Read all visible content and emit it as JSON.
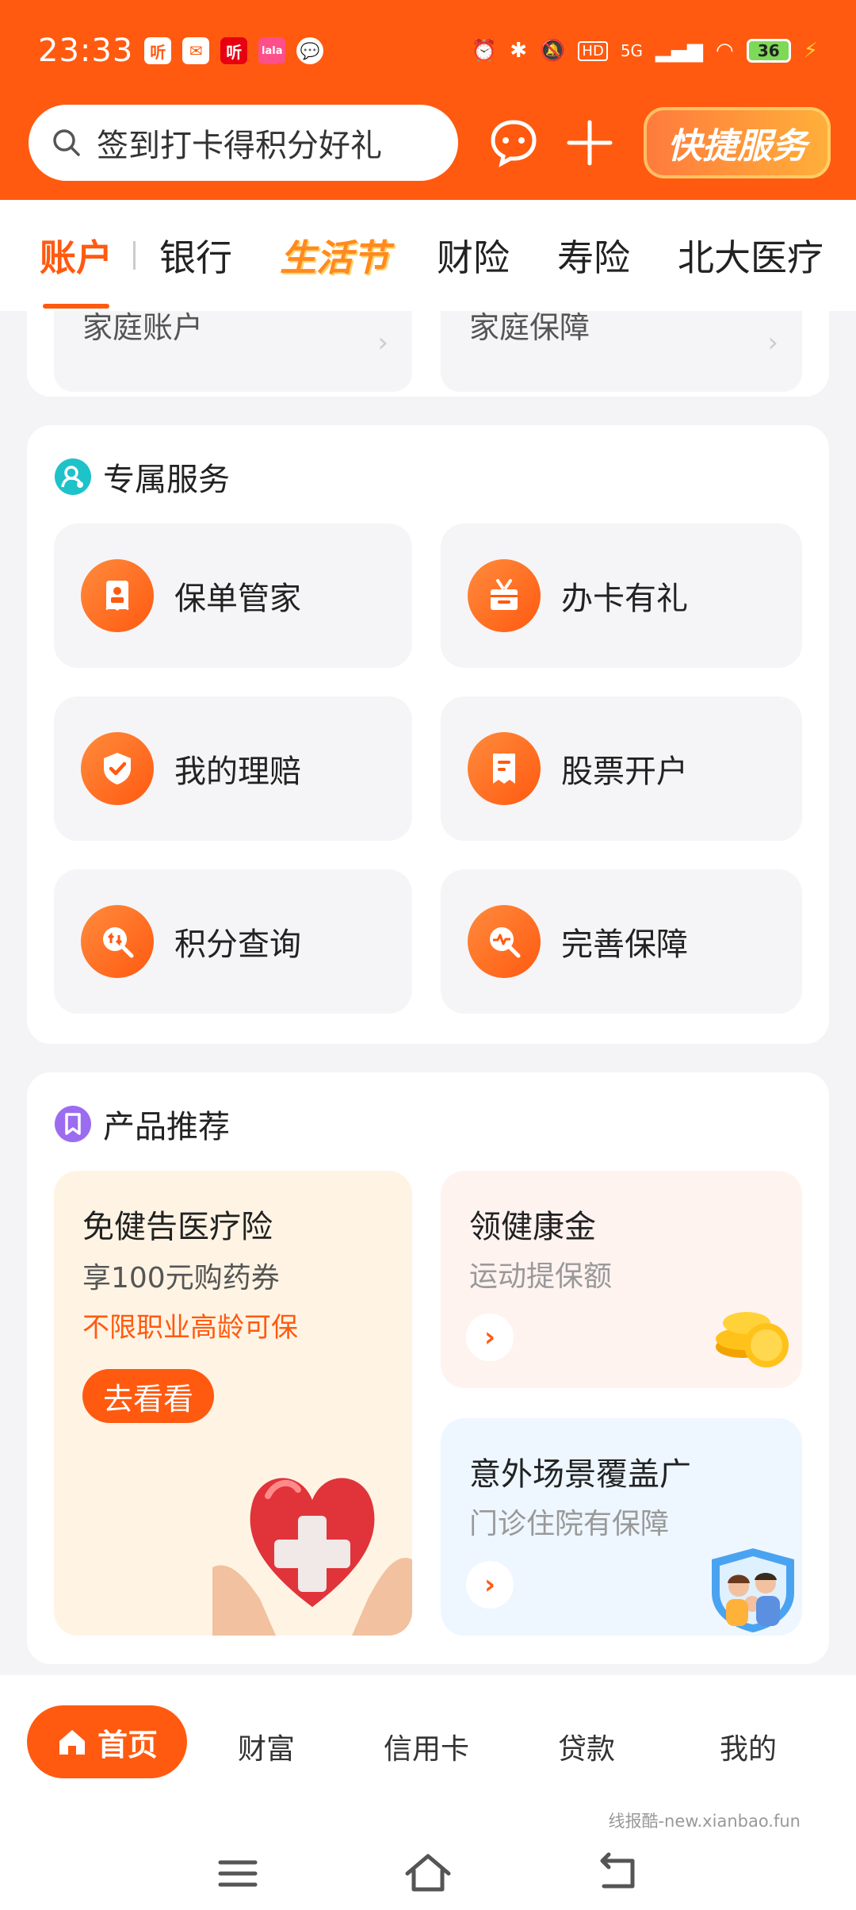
{
  "status_bar": {
    "time": "23:33",
    "app_icons": [
      "听",
      "✉",
      "听",
      "lala",
      "💬"
    ],
    "network": "5G",
    "battery": "36"
  },
  "search": {
    "placeholder": "签到打卡得积分好礼",
    "quick_service": "快捷服务"
  },
  "tabs": [
    {
      "label": "账户"
    },
    {
      "label": "银行"
    },
    {
      "label": "生活节"
    },
    {
      "label": "财险"
    },
    {
      "label": "寿险"
    },
    {
      "label": "北大医疗"
    }
  ],
  "top_card": {
    "left_label": "家庭账户",
    "right_label": "家庭保障"
  },
  "exclusive_service": {
    "title": "专属服务",
    "items": [
      {
        "label": "保单管家",
        "icon": "policy-icon"
      },
      {
        "label": "办卡有礼",
        "icon": "gift-icon"
      },
      {
        "label": "我的理赔",
        "icon": "shield-check-icon"
      },
      {
        "label": "股票开户",
        "icon": "receipt-icon"
      },
      {
        "label": "积分查询",
        "icon": "points-search-icon"
      },
      {
        "label": "完善保障",
        "icon": "pulse-search-icon"
      }
    ]
  },
  "products": {
    "title": "产品推荐",
    "main": {
      "title": "免健告医疗险",
      "subtitle": "享100元购药券",
      "highlight": "不限职业高龄可保",
      "button": "去看看"
    },
    "side_a": {
      "title": "领健康金",
      "subtitle": "运动提保额"
    },
    "side_b": {
      "title": "意外场景覆盖广",
      "subtitle": "门诊住院有保障"
    }
  },
  "bottom_nav": {
    "items": [
      "首页",
      "财富",
      "信用卡",
      "贷款",
      "我的"
    ]
  },
  "watermark": "线报酷-new.xianbao.fun",
  "colors": {
    "brand_orange": "#ff5a10",
    "card_bg": "#ffffff",
    "page_bg": "#f4f4f6"
  }
}
